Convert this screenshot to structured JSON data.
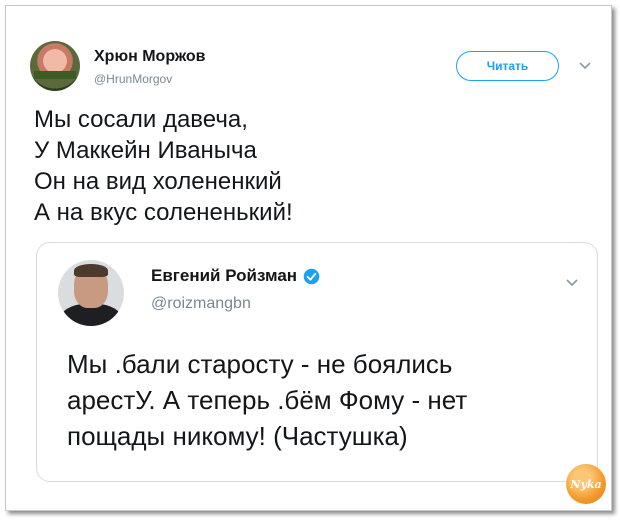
{
  "tweet": {
    "author": {
      "name": "Хрюн Моржов",
      "handle": "@HrunMorgov"
    },
    "follow_label": "Читать",
    "text_lines": [
      "Мы сосали давеча,",
      "У Маккейн Иваныча",
      "Он на вид холененкий",
      "А на вкус солененький!"
    ],
    "quoted": {
      "author": {
        "name": "Евгений Ройзман",
        "handle": "@roizmangbn",
        "verified": true
      },
      "text_lines": [
        "Мы .бали старосту - не боялись",
        "арестУ. А теперь .бём Фому - нет",
        "пощады никому! (Частушка)"
      ]
    }
  },
  "watermark": {
    "text": "Nyka"
  },
  "colors": {
    "accent": "#1da1f2",
    "text": "#14171a",
    "secondary": "#7a8793",
    "border": "#d5dde3"
  }
}
